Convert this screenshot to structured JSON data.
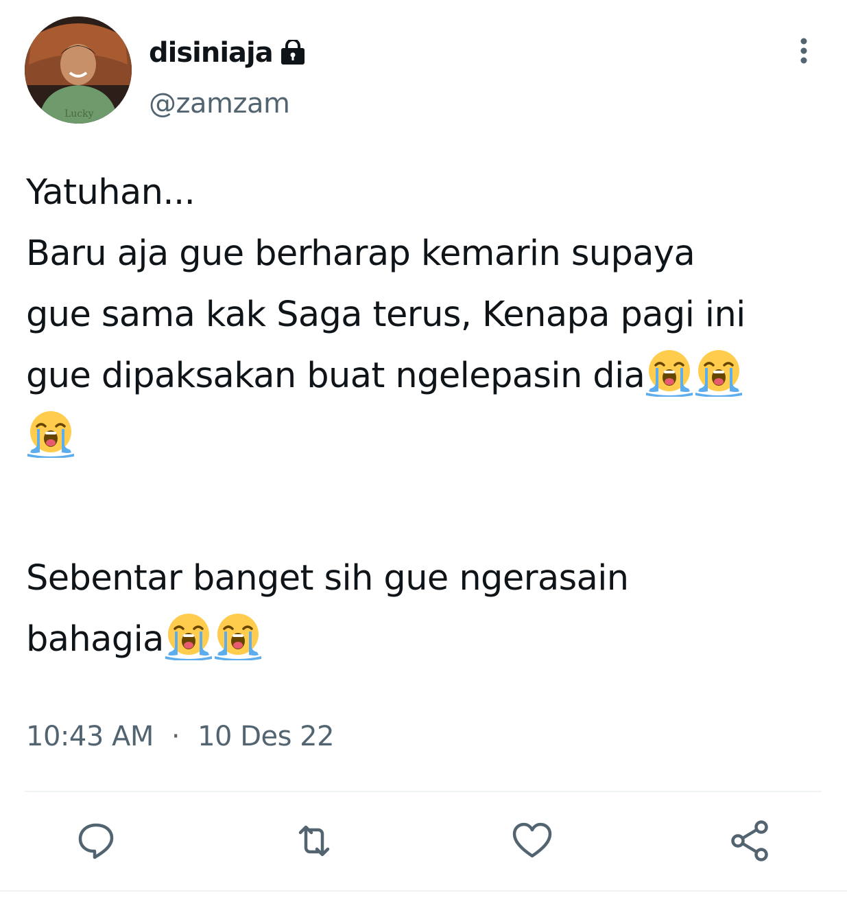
{
  "user": {
    "display_name": "disiniaja",
    "handle": "@zamzam",
    "avatar_icon": "profile-photo",
    "avatar_shirt_text": "Lucky",
    "protected_icon": "lock-icon"
  },
  "tweet": {
    "lines": [
      "Yatuhan...",
      "Baru aja gue berharap kemarin supaya",
      "gue sama kak Saga terus, Kenapa pagi ini",
      "gue dipaksakan buat ngelepasin dia",
      "",
      "Sebentar banget sih gue ngerasain",
      "bahagia"
    ],
    "emoji": "😭",
    "time": "10:43 AM",
    "separator": "·",
    "date": "10 Des 22"
  },
  "actions": {
    "reply_icon": "reply-icon",
    "retweet_icon": "retweet-icon",
    "like_icon": "heart-icon",
    "share_icon": "share-icon"
  },
  "colors": {
    "text": "#0f1419",
    "secondary": "#536471",
    "divider": "#eff3f4",
    "emoji_face": "#ffcc4d",
    "emoji_tears": "#5dadec"
  }
}
